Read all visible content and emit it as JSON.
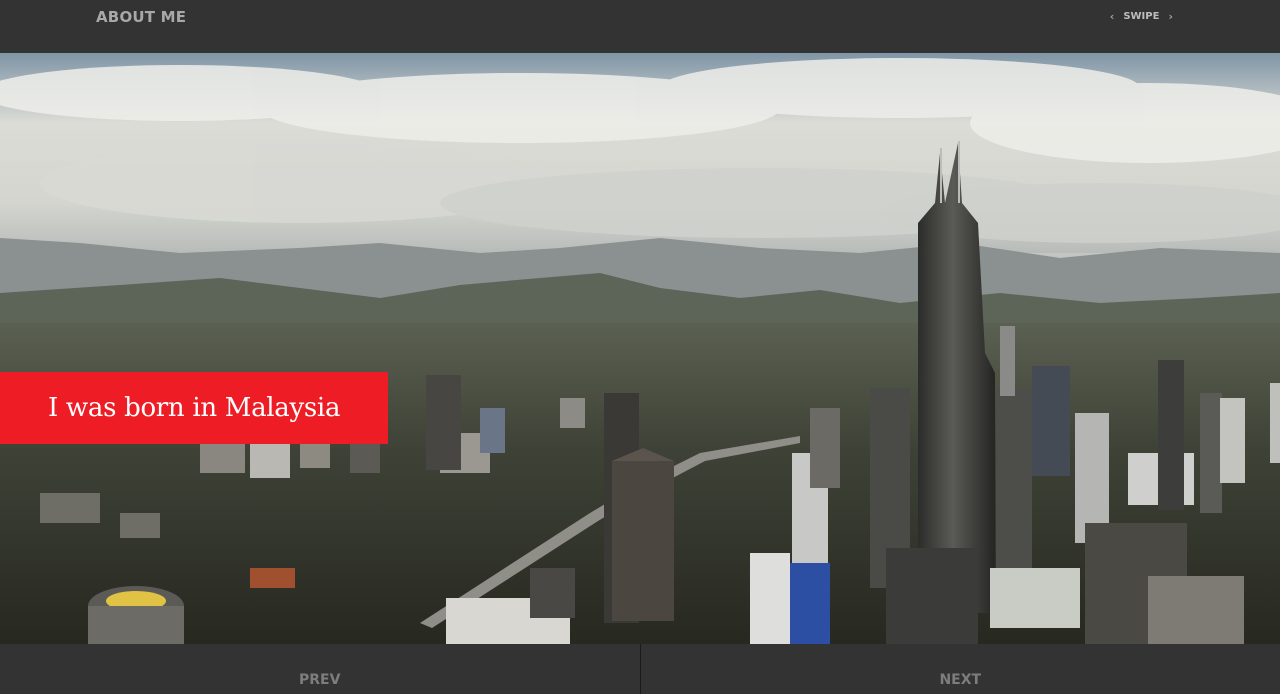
{
  "header": {
    "title": "ABOUT ME",
    "swipe_label": "SWIPE",
    "prev_glyph": "‹",
    "next_glyph": "›"
  },
  "slide": {
    "caption": "I was born in Malaysia",
    "caption_color": "#ee1c25",
    "image_subject": "Kuala Lumpur skyline with Petronas Towers"
  },
  "footer": {
    "prev_label": "PREV",
    "next_label": "NEXT"
  },
  "colors": {
    "bar_background": "#333333",
    "title_text": "#a8a8a8",
    "nav_text": "#7d7d7d"
  }
}
